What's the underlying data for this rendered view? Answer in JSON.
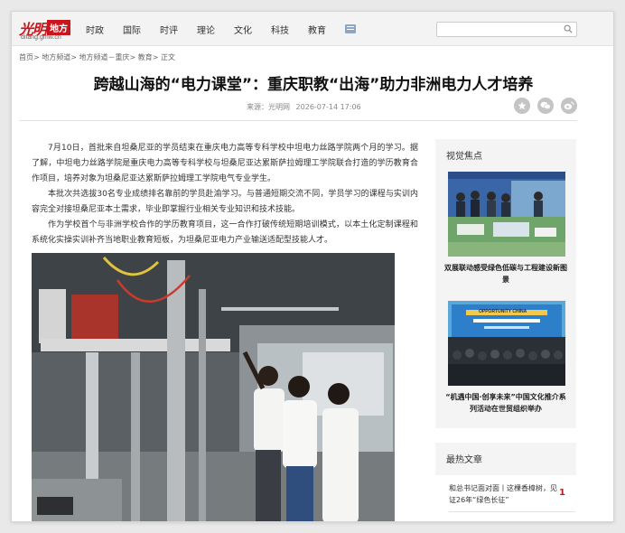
{
  "logo": {
    "mark": "光明",
    "box": "地方",
    "sub": "difang.gmw.cn"
  },
  "nav": [
    "时政",
    "国际",
    "时评",
    "理论",
    "文化",
    "科技",
    "教育"
  ],
  "search": {
    "placeholder": ""
  },
  "breadcrumb": [
    "首页",
    "地方频道",
    "地方频道－重庆",
    "教育",
    "正文"
  ],
  "breadcrumb_sep": ">",
  "article": {
    "title": "跨越山海的“电力课堂”：重庆职教“出海”助力非洲电力人才培养",
    "source": "来源：光明网",
    "datetime": "2026-07-14 17:06",
    "paragraphs": [
      "7月10日，首批来自坦桑尼亚的学员结束在重庆电力高等专科学校中坦电力丝路学院两个月的学习。据了解，中坦电力丝路学院是重庆电力高等专科学校与坦桑尼亚达累斯萨拉姆理工学院联合打造的学历教育合作项目，培养对象为坦桑尼亚达累斯萨拉姆理工学院电气专业学生。",
      "本批次共选拔30名专业成绩排名靠前的学员赴渝学习。与普通短期交流不同，学员学习的课程与实训内容完全对接坦桑尼亚本土需求，毕业即掌握行业相关专业知识和技术技能。",
      "作为学校首个与非洲学校合作的学历教育项目，这一合作打破传统短期培训模式，以本土化定制课程和系统化实操实训补齐当地职业教育短板，为坦桑尼亚电力产业输送适配型技能人才。"
    ]
  },
  "sidebar": {
    "focus_title": "视觉焦点",
    "focus_items": [
      {
        "caption": "双展联动感受绿色低碳与工程建设新图景"
      },
      {
        "caption": "“机遇中国·创享未来”中国文化推介系列活动在世贸组织举办",
        "screen_text": "OPPORTUNITY CHINA"
      }
    ],
    "hot_title": "最热文章",
    "hot_items": [
      {
        "text": "和总书记面对面丨这棵香樟树，见证26年“绿色长征”",
        "rank": "1"
      }
    ]
  },
  "colors": {
    "brand": "#c8161d",
    "topbar": "#f3f3f3",
    "sidebar_bg": "#f4f4f4"
  },
  "icons": [
    "search-icon",
    "comment-share-icon",
    "wechat-icon",
    "weibo-icon",
    "menu-grid-icon"
  ]
}
